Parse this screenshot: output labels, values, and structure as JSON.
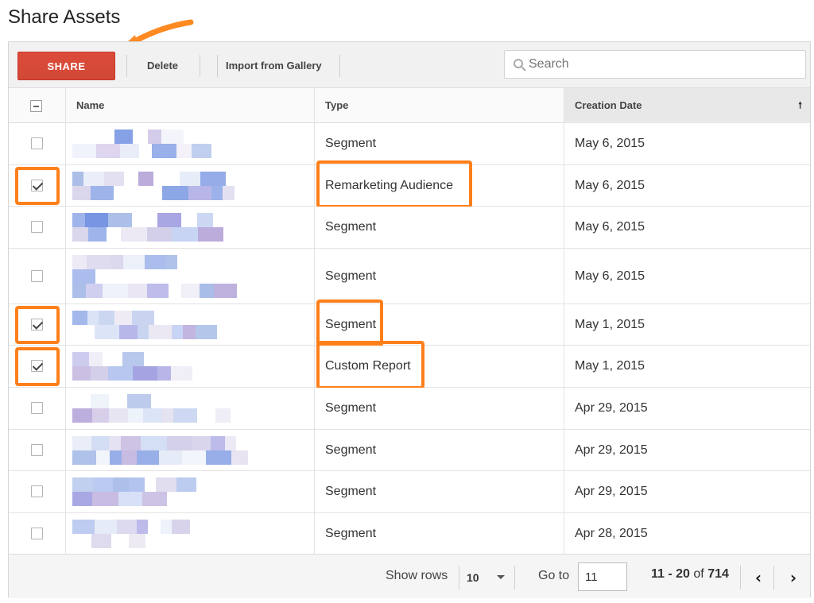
{
  "page": {
    "title": "Share Assets"
  },
  "toolbar": {
    "share_label": "SHARE",
    "delete_label": "Delete",
    "import_label": "Import from Gallery",
    "search_placeholder": "Search"
  },
  "table": {
    "columns": {
      "name": "Name",
      "type": "Type",
      "date": "Creation Date"
    },
    "rows": [
      {
        "checked": false,
        "type": "Segment",
        "date": "May 6, 2015"
      },
      {
        "checked": true,
        "type": "Remarketing Audience",
        "date": "May 6, 2015"
      },
      {
        "checked": false,
        "type": "Segment",
        "date": "May 6, 2015"
      },
      {
        "checked": false,
        "type": "Segment",
        "date": "May 6, 2015"
      },
      {
        "checked": true,
        "type": "Segment",
        "date": "May 1, 2015"
      },
      {
        "checked": true,
        "type": "Custom Report",
        "date": "May 1, 2015"
      },
      {
        "checked": false,
        "type": "Segment",
        "date": "Apr 29, 2015"
      },
      {
        "checked": false,
        "type": "Segment",
        "date": "Apr 29, 2015"
      },
      {
        "checked": false,
        "type": "Segment",
        "date": "Apr 29, 2015"
      },
      {
        "checked": false,
        "type": "Segment",
        "date": "Apr 28, 2015"
      }
    ]
  },
  "footer": {
    "show_rows_label": "Show rows",
    "rows_value": "10",
    "goto_label": "Go to",
    "goto_value": "11",
    "range_text": "11 - 20",
    "of_text": "of",
    "total": "714",
    "prev_icon": "‹",
    "next_icon": "›"
  },
  "colors": {
    "share": "#dd4b39",
    "highlight": "#ff7f1a"
  }
}
